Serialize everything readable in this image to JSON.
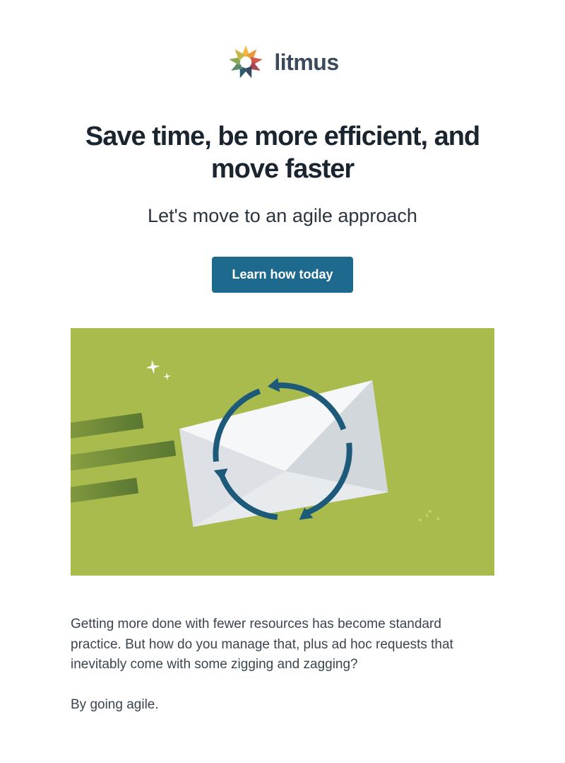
{
  "logo": {
    "name": "litmus"
  },
  "hero": {
    "headline": "Save time, be more efficient, and move faster",
    "subheadline": "Let's move to an agile approach",
    "cta_label": "Learn how today"
  },
  "body": {
    "paragraph1": "Getting more done with fewer resources has become standard practice. But how do you manage that, plus ad hoc requests that inevitably come with some zigging and zagging?",
    "paragraph2": "By going agile."
  },
  "colors": {
    "accent": "#1d6a8e",
    "hero_bg": "#a9bb4c",
    "text_dark": "#1a2530",
    "text_body": "#3a4551"
  }
}
